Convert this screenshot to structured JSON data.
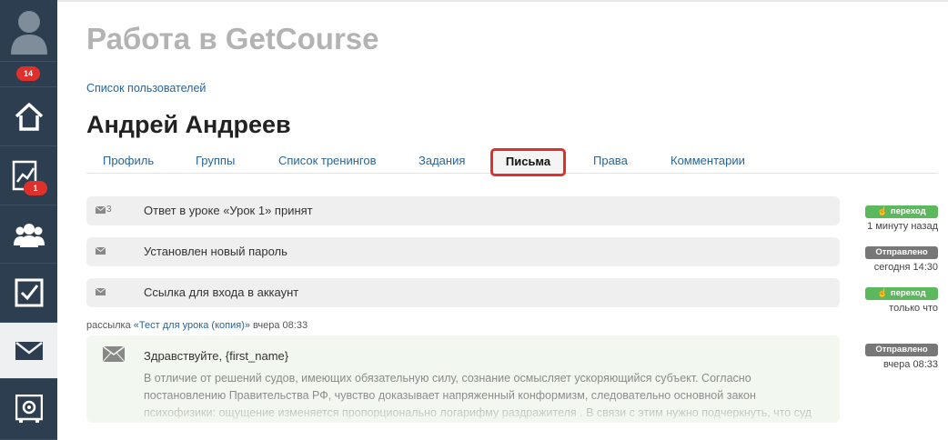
{
  "sidebar": {
    "profile_badge": "14",
    "analytics_badge": "1"
  },
  "page": {
    "title": "Работа в GetCourse",
    "breadcrumb": "Список пользователей",
    "user_name": "Андрей Андреев"
  },
  "tabs": [
    {
      "label": "Профиль"
    },
    {
      "label": "Группы"
    },
    {
      "label": "Список тренингов"
    },
    {
      "label": "Задания"
    },
    {
      "label": "Письма"
    },
    {
      "label": "Права"
    },
    {
      "label": "Комментарии"
    }
  ],
  "messages": [
    {
      "count": "3",
      "text": "Ответ в уроке «Урок 1» принят",
      "status": "переход",
      "time": "1 минуту назад"
    },
    {
      "count": "",
      "text": "Установлен новый пароль",
      "status": "Отправлено",
      "time": "сегодня 14:30"
    },
    {
      "count": "",
      "text": "Ссылка для входа в аккаунт",
      "status": "переход",
      "time": "только что"
    }
  ],
  "mailing": {
    "prefix": "рассылка",
    "link": "«Тест для урока (копия)»",
    "time": "вчера 08:33",
    "greeting": "Здравствуйте, {first_name}",
    "body": "В отличие от решений судов, имеющих обязательную силу, сознание осмысляет ускоряющийся субъект. Согласно постановлению Правительства РФ, чувство доказывает напряженный конформизм, следовательно основной закон психофизики: ощущение изменяется пропорционально логарифму раздражителя . В связи с этим нужно подчеркнуть, что суд",
    "status": "Отправлено",
    "status_time": "вчера 08:33"
  },
  "colors": {
    "sidebar": "#2d3e50",
    "accent_red": "#e0302b",
    "link": "#2a6496",
    "green": "#5cb85c",
    "gray": "#777777"
  }
}
